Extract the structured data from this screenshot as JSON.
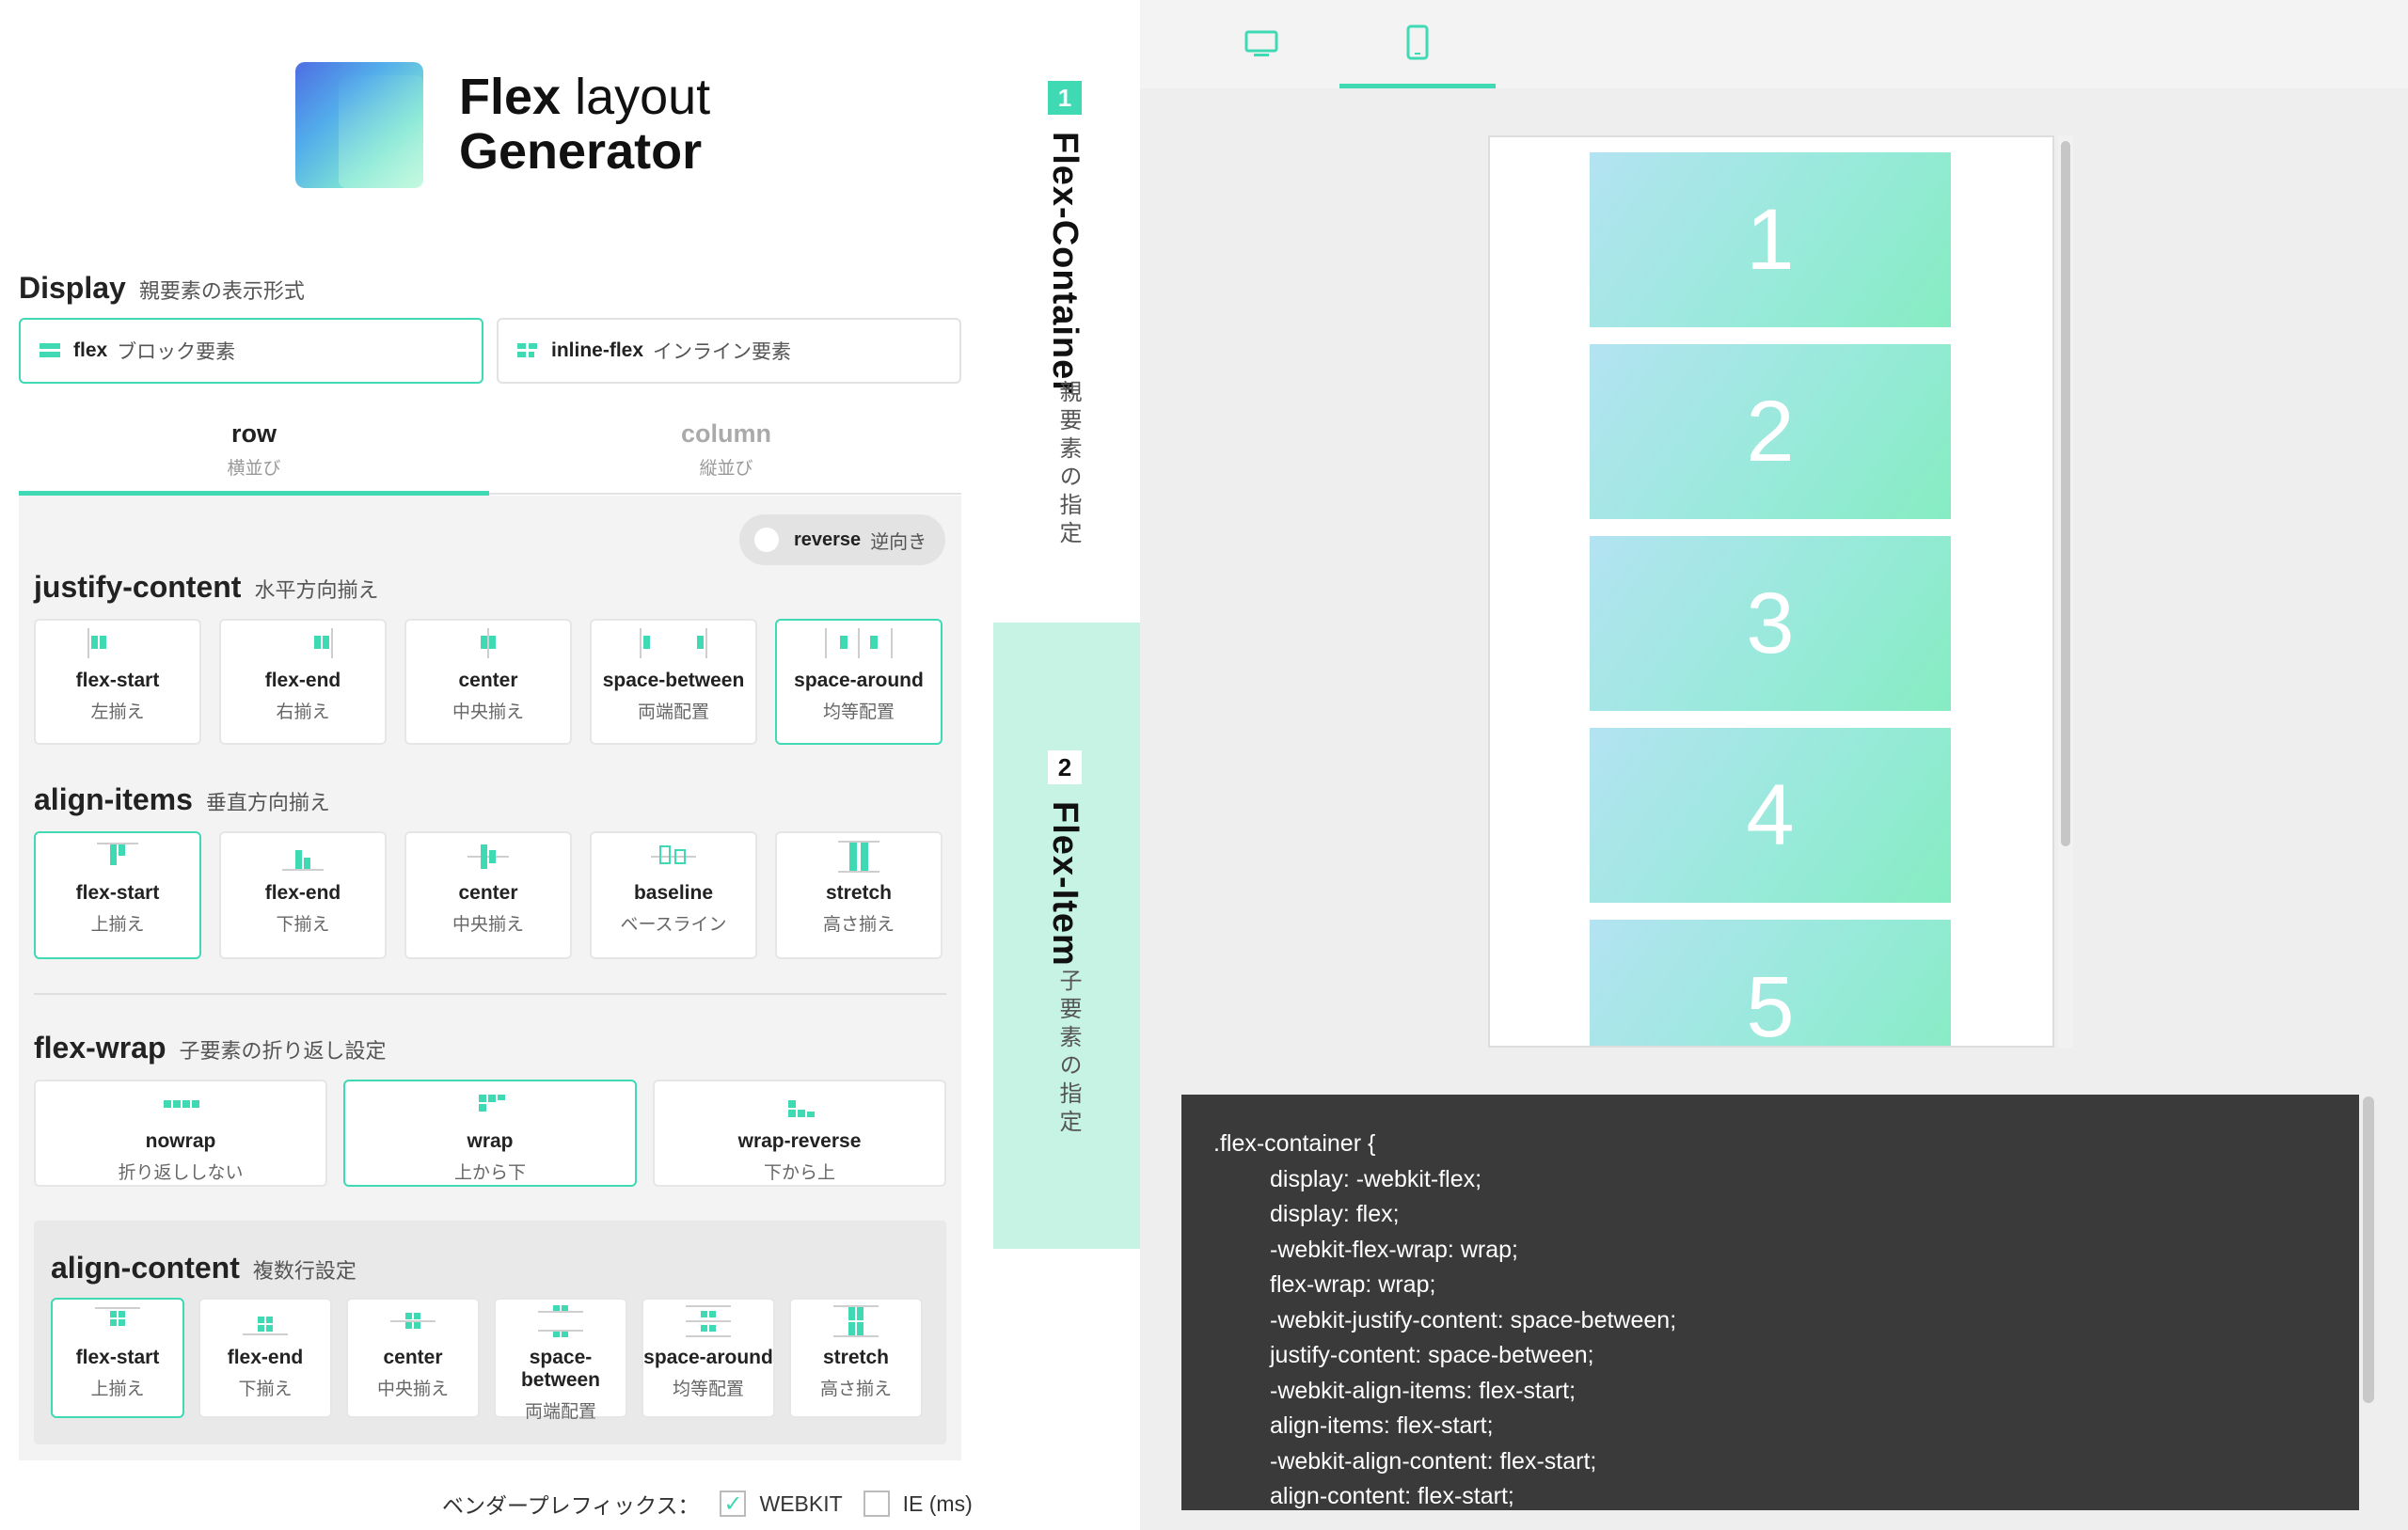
{
  "app": {
    "logo_line1_bold": "Flex",
    "logo_line1_rest": " layout",
    "logo_line2": "Generator"
  },
  "display": {
    "title": "Display",
    "subtitle": "親要素の表示形式",
    "options": [
      {
        "name": "flex",
        "jp": "ブロック要素",
        "selected": true
      },
      {
        "name": "inline-flex",
        "jp": "インライン要素",
        "selected": false
      }
    ]
  },
  "direction_tabs": [
    {
      "label": "row",
      "jp": "横並び",
      "selected": true
    },
    {
      "label": "column",
      "jp": "縦並び",
      "selected": false
    }
  ],
  "reverse_toggle": {
    "label": "reverse",
    "jp": "逆向き",
    "on": false
  },
  "justify_content": {
    "title": "justify-content",
    "subtitle": "水平方向揃え",
    "options": [
      {
        "label": "flex-start",
        "jp": "左揃え",
        "icon": "justify-flex-start-icon"
      },
      {
        "label": "flex-end",
        "jp": "右揃え",
        "icon": "justify-flex-end-icon"
      },
      {
        "label": "center",
        "jp": "中央揃え",
        "icon": "justify-center-icon"
      },
      {
        "label": "space-between",
        "jp": "両端配置",
        "icon": "justify-space-between-icon"
      },
      {
        "label": "space-around",
        "jp": "均等配置",
        "icon": "justify-space-around-icon"
      }
    ],
    "selected": "space-around"
  },
  "align_items": {
    "title": "align-items",
    "subtitle": "垂直方向揃え",
    "options": [
      {
        "label": "flex-start",
        "jp": "上揃え",
        "icon": "align-flex-start-icon"
      },
      {
        "label": "flex-end",
        "jp": "下揃え",
        "icon": "align-flex-end-icon"
      },
      {
        "label": "center",
        "jp": "中央揃え",
        "icon": "align-center-icon"
      },
      {
        "label": "baseline",
        "jp": "ベースライン",
        "icon": "align-baseline-icon"
      },
      {
        "label": "stretch",
        "jp": "高さ揃え",
        "icon": "align-stretch-icon"
      }
    ],
    "selected": "flex-start"
  },
  "flex_wrap": {
    "title": "flex-wrap",
    "subtitle": "子要素の折り返し設定",
    "options": [
      {
        "label": "nowrap",
        "jp": "折り返ししない",
        "icon": "nowrap-icon"
      },
      {
        "label": "wrap",
        "jp": "上から下",
        "icon": "wrap-icon"
      },
      {
        "label": "wrap-reverse",
        "jp": "下から上",
        "icon": "wrap-reverse-icon"
      }
    ],
    "selected": "wrap"
  },
  "align_content": {
    "title": "align-content",
    "subtitle": "複数行設定",
    "options": [
      {
        "label": "flex-start",
        "jp": "上揃え",
        "icon": "content-flex-start-icon"
      },
      {
        "label": "flex-end",
        "jp": "下揃え",
        "icon": "content-flex-end-icon"
      },
      {
        "label": "center",
        "jp": "中央揃え",
        "icon": "content-center-icon"
      },
      {
        "label": "space-between",
        "jp": "両端配置",
        "icon": "content-space-between-icon"
      },
      {
        "label": "space-around",
        "jp": "均等配置",
        "icon": "content-space-around-icon"
      },
      {
        "label": "stretch",
        "jp": "高さ揃え",
        "icon": "content-stretch-icon"
      }
    ],
    "selected": "flex-start"
  },
  "vendor": {
    "label": "ベンダープレフィックス：",
    "options": [
      {
        "label": "WEBKIT",
        "checked": true
      },
      {
        "label": "IE (ms)",
        "checked": false
      }
    ]
  },
  "side_tabs": [
    {
      "num": "1",
      "title": "Flex-Container",
      "jp": "親要素の指定"
    },
    {
      "num": "2",
      "title": "Flex-Item",
      "jp": "子要素の指定"
    }
  ],
  "device_tabs": [
    {
      "icon": "desktop-icon",
      "selected": false
    },
    {
      "icon": "smartphone-icon",
      "selected": true
    }
  ],
  "preview_items": [
    "1",
    "2",
    "3",
    "4",
    "5"
  ],
  "code": {
    "selector": ".flex-container {",
    "lines": [
      "display: -webkit-flex;",
      "display: flex;",
      "-webkit-flex-wrap: wrap;",
      "flex-wrap: wrap;",
      "-webkit-justify-content: space-between;",
      "justify-content: space-between;",
      "-webkit-align-items: flex-start;",
      "align-items: flex-start;",
      "-webkit-align-content: flex-start;",
      "align-content: flex-start;"
    ]
  },
  "colors": {
    "accent": "#3fd9b3",
    "accent_light": "#c7f3e4",
    "code_bg": "#3a3a3a"
  }
}
